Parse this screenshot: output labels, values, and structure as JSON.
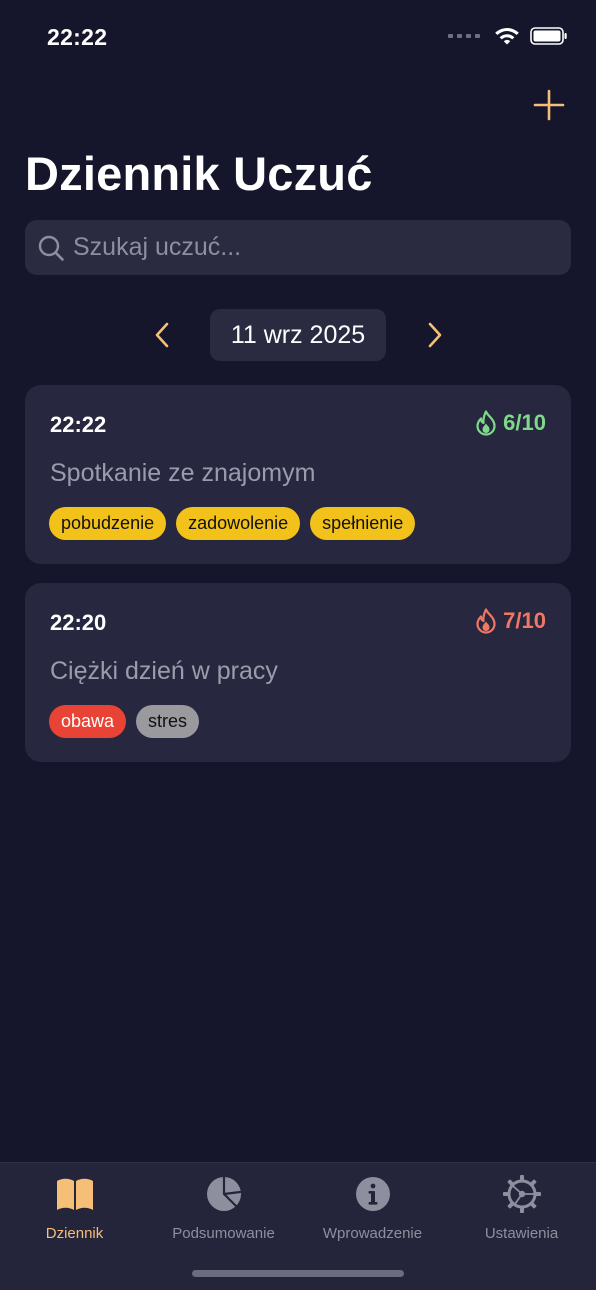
{
  "status_bar": {
    "time": "22:22"
  },
  "header": {
    "title": "Dziennik Uczuć"
  },
  "search": {
    "placeholder": "Szukaj uczuć..."
  },
  "date_nav": {
    "date": "11 wrz 2025"
  },
  "entries": [
    {
      "time": "22:22",
      "intensity": "6/10",
      "intensity_color": "#7fd98a",
      "title": "Spotkanie ze znajomym",
      "tags": [
        {
          "label": "pobudzenie",
          "color": "#f3c21a"
        },
        {
          "label": "zadowolenie",
          "color": "#f3c21a"
        },
        {
          "label": "spełnienie",
          "color": "#f3c21a"
        }
      ]
    },
    {
      "time": "22:20",
      "intensity": "7/10",
      "intensity_color": "#f07763",
      "title": "Ciężki dzień w pracy",
      "tags": [
        {
          "label": "obawa",
          "color": "#e94335"
        },
        {
          "label": "stres",
          "color": "#9a9a9e"
        }
      ]
    }
  ],
  "tab_bar": {
    "tabs": [
      {
        "label": "Dziennik",
        "icon": "book-icon",
        "active": true
      },
      {
        "label": "Podsumowanie",
        "icon": "pie-chart-icon",
        "active": false
      },
      {
        "label": "Wprowadzenie",
        "icon": "info-icon",
        "active": false
      },
      {
        "label": "Ustawienia",
        "icon": "gear-icon",
        "active": false
      }
    ]
  },
  "colors": {
    "background": "#15162b",
    "card": "#272840",
    "accent": "#f5bf78",
    "tab_inactive": "#8e8f9e"
  }
}
